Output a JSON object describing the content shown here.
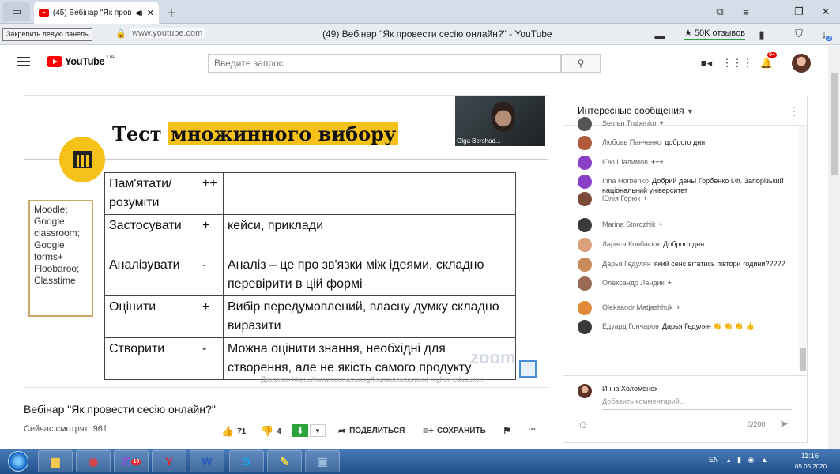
{
  "browser": {
    "tab_title": "(45) Вебінар \"Як прове",
    "sidebar_tooltip": "Закрепить левую панель",
    "url": "www.youtube.com",
    "page_title": "(49) Вебінар \"Як провести сесію онлайн?\" - YouTube",
    "reviews_badge": "★ 50K отзывов",
    "ext_badge": "3"
  },
  "youtube": {
    "logo_text": "YouTube",
    "region": "UA",
    "search_placeholder": "Введите запрос",
    "notification_count": "9+"
  },
  "slide": {
    "title_prefix": "Тест ",
    "title_highlight": "множинного вибору",
    "tools": [
      "Moodle;",
      "Google",
      "classroom;",
      "Google",
      "forms+",
      "Floobaroo;",
      "Classtime"
    ],
    "rubric": [
      {
        "level": "Пам'ятати/ розуміти",
        "mark": "++",
        "note": ""
      },
      {
        "level": "Застосувати",
        "mark": "+",
        "note": "кейси, приклади"
      },
      {
        "level": "Аналізувати",
        "mark": "-",
        "note": "Аналіз – це про зв'язки між ідеями, складно перевірити в цій формі"
      },
      {
        "level": "Оцінити",
        "mark": "+",
        "note": "Вибір передумовлений, власну думку складно виразити"
      },
      {
        "level": "Створити",
        "mark": "-",
        "note": "Можна оцінити знання, необхідні для створення, але не якість самого продукту"
      }
    ],
    "source": "Джерело https://www.coursera.org/learn/assessment-higher-education",
    "webcam_name": "Olga Bershad...",
    "zoom_watermark": "zoom"
  },
  "video_info": {
    "title": "Вебінар \"Як провести сесію онлайн?\"",
    "viewers": "Сейчас смотрят: 961",
    "likes": "71",
    "dislikes": "4",
    "share_label": "ПОДЕЛИТЬСЯ",
    "save_label": "СОХРАНИТЬ"
  },
  "chat": {
    "header": "Интересные сообщения",
    "messages": [
      {
        "author": "Semen Trubenko",
        "text": "+"
      },
      {
        "author": "Любовь Панченко",
        "text": "доброго дня"
      },
      {
        "author": "Юю Шалимов",
        "text": "+++"
      },
      {
        "author": "Inna Horbenko",
        "text": "Добрий день! Горбенко І.Ф. Запорізький національний університет"
      },
      {
        "author": "Юлія Горюк",
        "text": "+"
      },
      {
        "author": "Marina Storozhik",
        "text": "+"
      },
      {
        "author": "Лариса Ковбасюк",
        "text": "Доброго дня"
      },
      {
        "author": "Дарья Гедулян",
        "text": "який сенс вітатись півтори години?????"
      },
      {
        "author": "Олександр Ландик",
        "text": "+"
      },
      {
        "author": "Oleksandr Matjashhuk",
        "text": "+"
      },
      {
        "author": "Едуард Гончаров",
        "text": "Дарья Гедулян 👏 👏 👏 👍"
      }
    ],
    "avatar_colors": [
      "#555",
      "#b05a3c",
      "#8a3fc5",
      "#8a3fc5",
      "#7b4b3a",
      "#3b3b3b",
      "#d9a17b",
      "#c98b5a",
      "#9a6a55",
      "#e08a3a",
      "#3a3a3a"
    ],
    "composer_name": "Инна Холоменок",
    "composer_placeholder": "Добавить комментарий...",
    "char_count": "0/200"
  },
  "taskbar": {
    "viber_badge": "10",
    "lang": "EN",
    "time": "11:16",
    "date": "05.05.2020"
  }
}
